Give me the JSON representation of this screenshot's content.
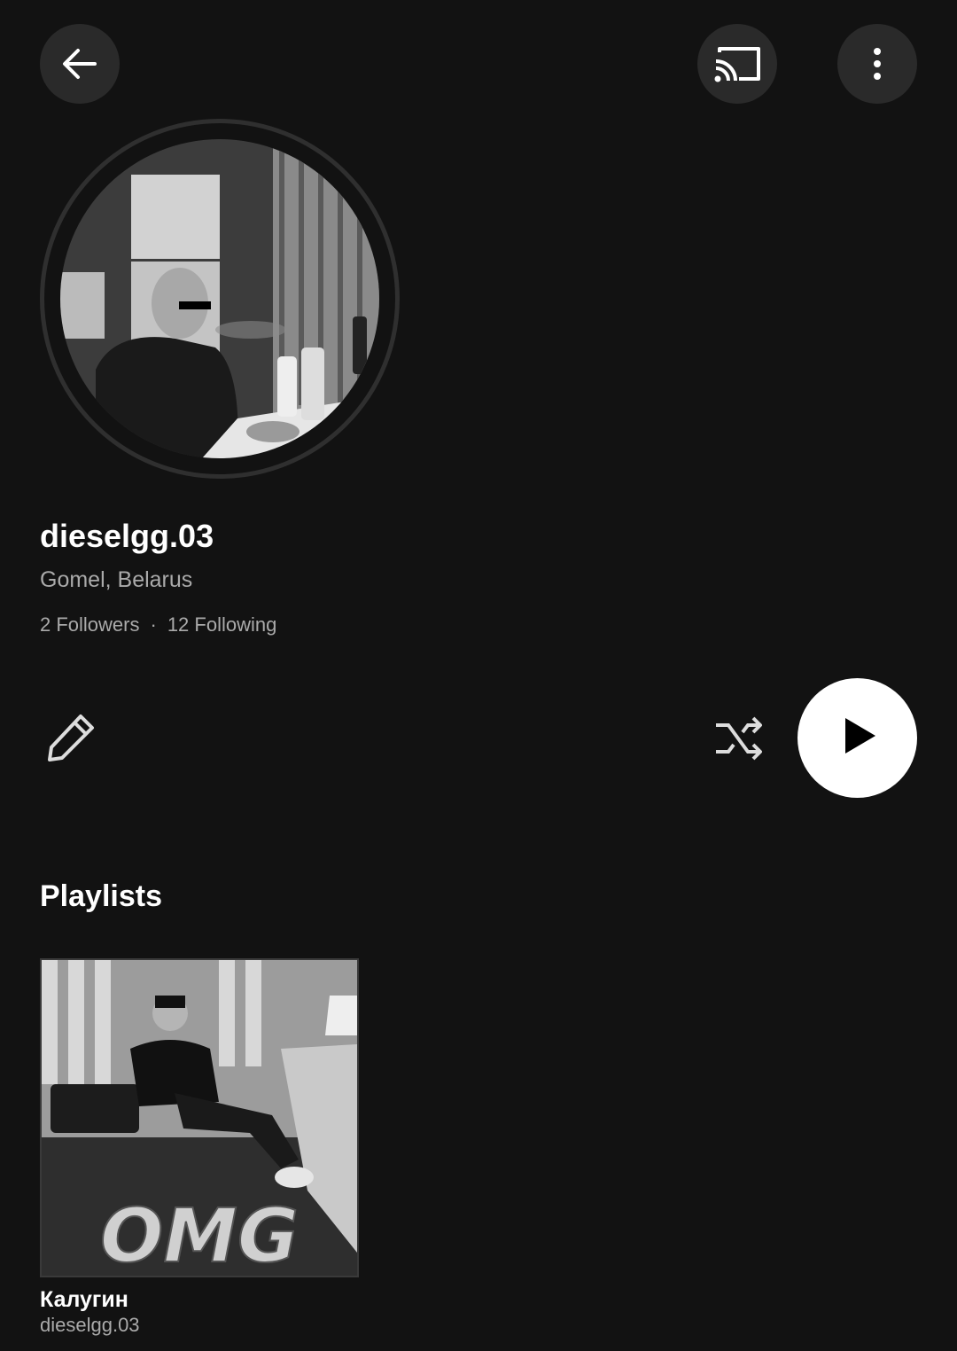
{
  "topbar": {
    "back_icon": "arrow-left-icon",
    "cast_icon": "cast-icon",
    "more_icon": "more-vertical-icon"
  },
  "profile": {
    "name": "dieselgg.03",
    "location": "Gomel, Belarus",
    "followers": "2 Followers",
    "separator": "·",
    "following": "12 Following"
  },
  "actions": {
    "edit_icon": "pencil-icon",
    "shuffle_icon": "shuffle-icon",
    "play_icon": "play-icon"
  },
  "playlists_section": {
    "title": "Playlists",
    "items": [
      {
        "title": "Калугин",
        "subtitle": "dieselgg.03",
        "cover_text": "OMG"
      }
    ]
  },
  "colors": {
    "background": "#121212",
    "button_bg": "#2a2a2a",
    "secondary_text": "#aaaaaa",
    "play_button": "#ffffff"
  }
}
